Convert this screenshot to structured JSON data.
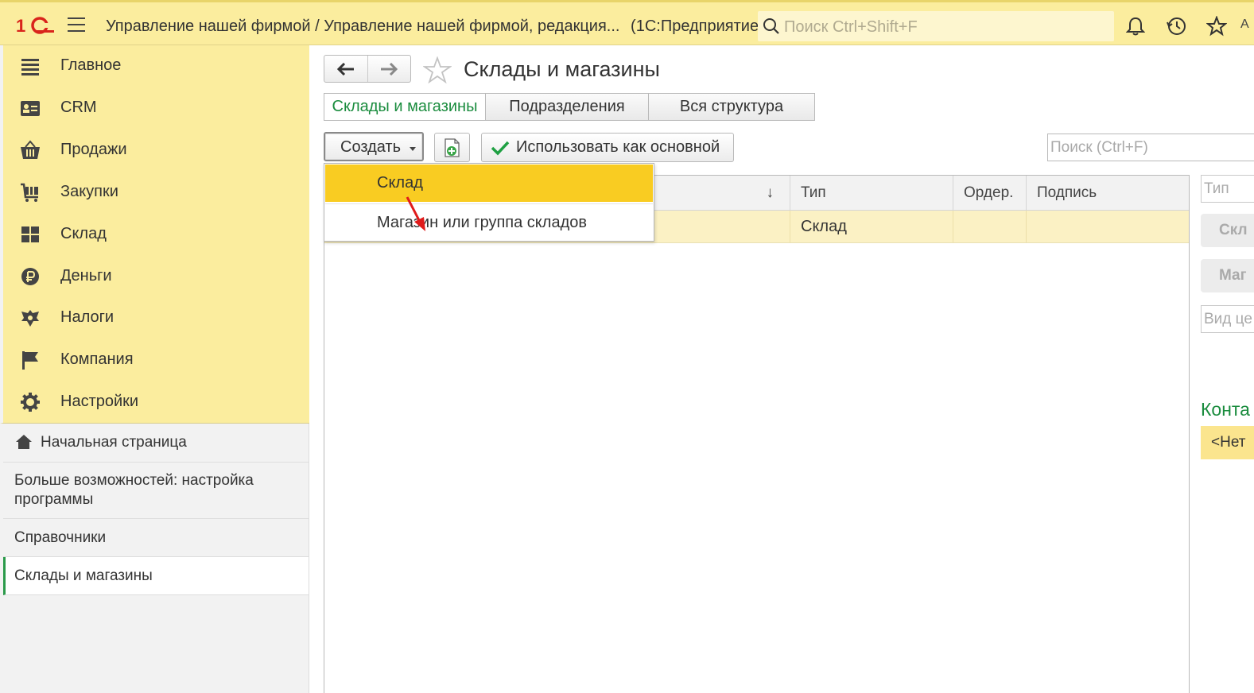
{
  "app": {
    "title": "Управление нашей фирмой / Управление нашей фирмой, редакция...",
    "platform": "(1С:Предприятие)",
    "search_placeholder": "Поиск Ctrl+Shift+F",
    "top_right_text": "А"
  },
  "sidebar": {
    "sections": [
      {
        "label": "Главное",
        "icon": "menu-list-icon"
      },
      {
        "label": "CRM",
        "icon": "contact-card-icon"
      },
      {
        "label": "Продажи",
        "icon": "basket-icon"
      },
      {
        "label": "Закупки",
        "icon": "cart-icon"
      },
      {
        "label": "Склад",
        "icon": "warehouse-grid-icon"
      },
      {
        "label": "Деньги",
        "icon": "ruble-icon"
      },
      {
        "label": "Налоги",
        "icon": "eagle-emblem-icon"
      },
      {
        "label": "Компания",
        "icon": "flag-icon"
      },
      {
        "label": "Настройки",
        "icon": "gear-icon"
      }
    ],
    "nav": [
      {
        "label": "Начальная страница"
      },
      {
        "label": "Больше возможностей: настройка программы"
      },
      {
        "label": "Справочники"
      },
      {
        "label": "Склады и магазины"
      }
    ]
  },
  "form": {
    "title": "Склады и магазины",
    "tabs": [
      "Склады и магазины",
      "Подразделения",
      "Вся структура"
    ],
    "create_label": "Создать",
    "use_main_label": "Использовать как основной",
    "search_placeholder": "Поиск (Ctrl+F)"
  },
  "dropdown": {
    "items": [
      "Склад",
      "Магазин или группа складов"
    ]
  },
  "table": {
    "sort_indicator": "↓",
    "headers": [
      "",
      "Тип",
      "Ордер.",
      "Подпись"
    ],
    "rows": [
      [
        "",
        "Склад",
        "",
        ""
      ]
    ]
  },
  "right_panel": {
    "type_placeholder": "Тип",
    "btn1": "Скл",
    "btn2": "Маг",
    "price_placeholder": "Вид це",
    "contacts_heading": "Конта",
    "contacts_value": "<Нет"
  },
  "colors": {
    "sidebar_bg": "#fbed9e",
    "accent_green": "#1a8c3e",
    "highlight": "#f9cc22",
    "logo_red": "#d9241c"
  }
}
